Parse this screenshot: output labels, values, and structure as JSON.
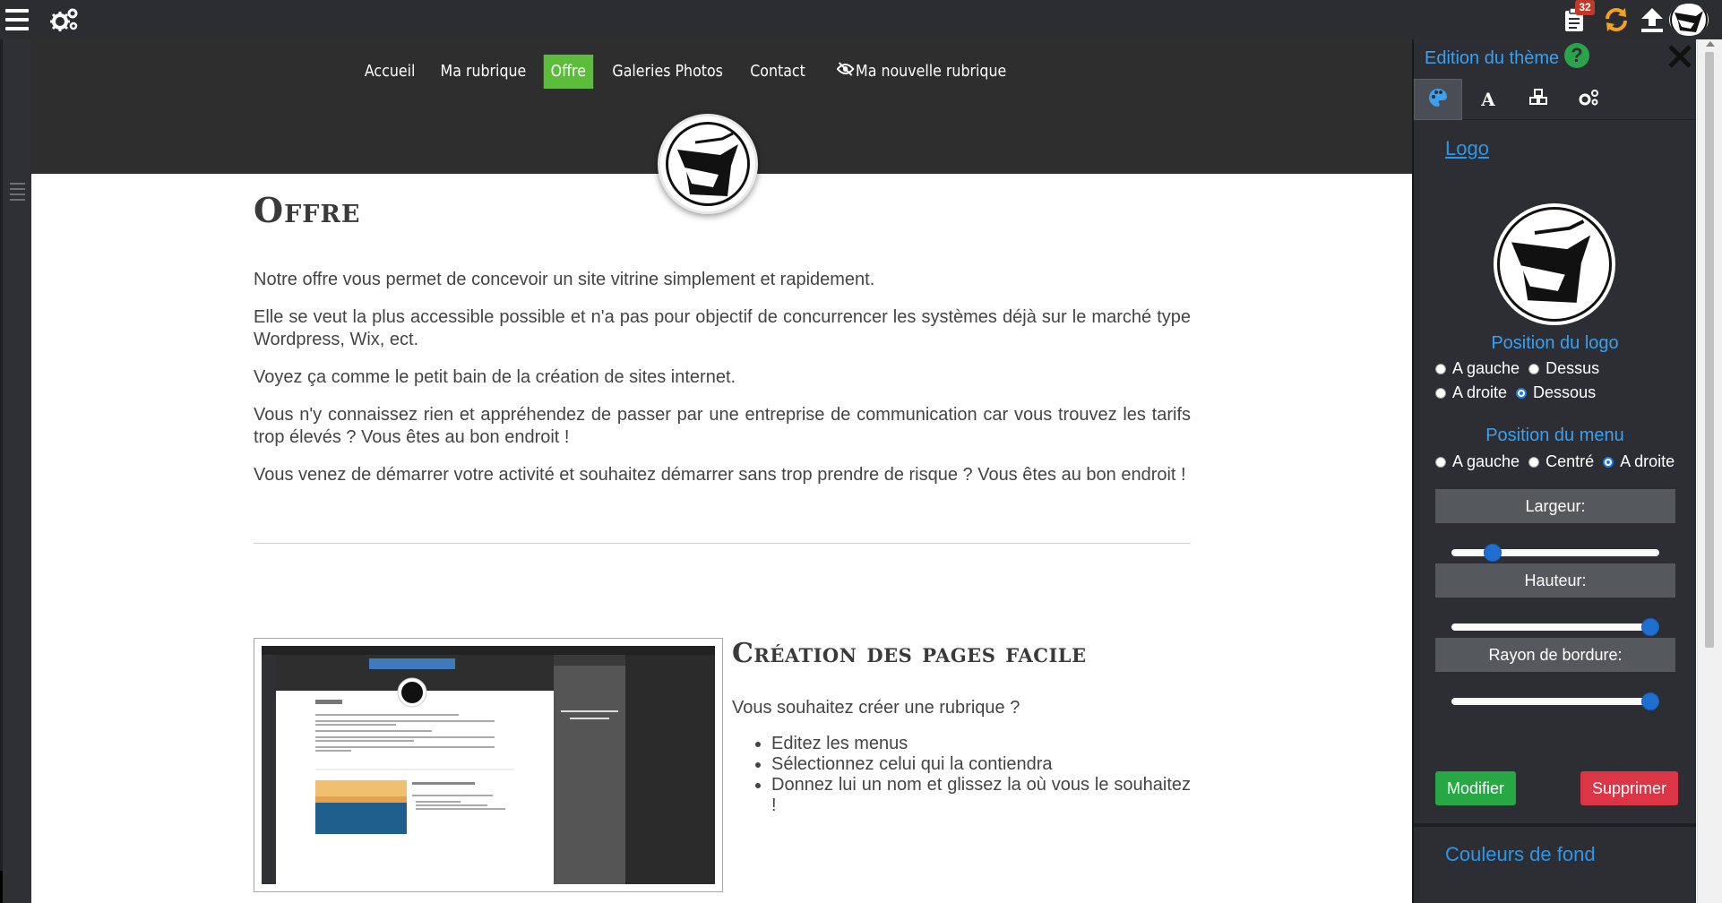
{
  "topbar": {
    "notification_count": "32",
    "icons": [
      "menu-icon",
      "gears-icon",
      "clipboard-icon",
      "sync-icon",
      "upload-icon",
      "avatar"
    ]
  },
  "site": {
    "nav": [
      {
        "label": "Accueil",
        "active": false
      },
      {
        "label": "Ma rubrique",
        "active": false
      },
      {
        "label": "Offre",
        "active": true
      },
      {
        "label": "Galeries Photos",
        "active": false
      },
      {
        "label": "Contact",
        "active": false
      },
      {
        "label": "Ma nouvelle rubrique",
        "active": false,
        "hidden_icon": "eye-slash-icon"
      }
    ],
    "active_color": "#5bbd3a"
  },
  "page": {
    "title": "Offre",
    "paragraphs": [
      "Notre offre vous permet de concevoir un site vitrine simplement et rapidement.",
      "Elle se veut la plus accessible possible et n'a pas pour objectif de concurrencer les systèmes déjà sur le marché type Wordpress, Wix, ect.",
      "Voyez ça comme le petit bain de la création de sites internet.",
      "Vous n'y connaissez rien et appréhendez de passer par une entreprise de communication car vous trouvez les tarifs trop élevés ? Vous êtes au bon endroit !",
      "Vous venez de démarrer votre activité et souhaitez démarrer sans trop prendre de risque ? Vous êtes au bon endroit !"
    ],
    "feature": {
      "title": "Création des pages facile",
      "intro": "Vous souhaitez créer une rubrique ?",
      "bullets": [
        "Editez les menus",
        "Sélectionnez celui qui la contiendra",
        "Donnez lui un nom et glissez la où vous le souhaitez !"
      ]
    }
  },
  "panel": {
    "title": "Edition du thème",
    "tabs": [
      "palette-icon",
      "font-icon",
      "cubes-icon",
      "gears-icon"
    ],
    "logo_section": "Logo",
    "logo_position": {
      "heading": "Position du logo",
      "options": [
        {
          "label": "A gauche",
          "checked": false
        },
        {
          "label": "Dessus",
          "checked": false
        },
        {
          "label": "A droite",
          "checked": false
        },
        {
          "label": "Dessous",
          "checked": true
        }
      ]
    },
    "menu_position": {
      "heading": "Position du menu",
      "options": [
        {
          "label": "A gauche",
          "checked": false
        },
        {
          "label": "Centré",
          "checked": false
        },
        {
          "label": "A droite",
          "checked": true
        }
      ]
    },
    "sliders": [
      {
        "label": "Largeur:",
        "value": 0.17
      },
      {
        "label": "Hauteur:",
        "value": 1.0
      },
      {
        "label": "Rayon de bordure:",
        "value": 1.0
      }
    ],
    "buttons": {
      "modify": "Modifier",
      "delete": "Supprimer"
    },
    "colors_section": "Couleurs de fond",
    "accent_color": "#3aa0f0"
  }
}
